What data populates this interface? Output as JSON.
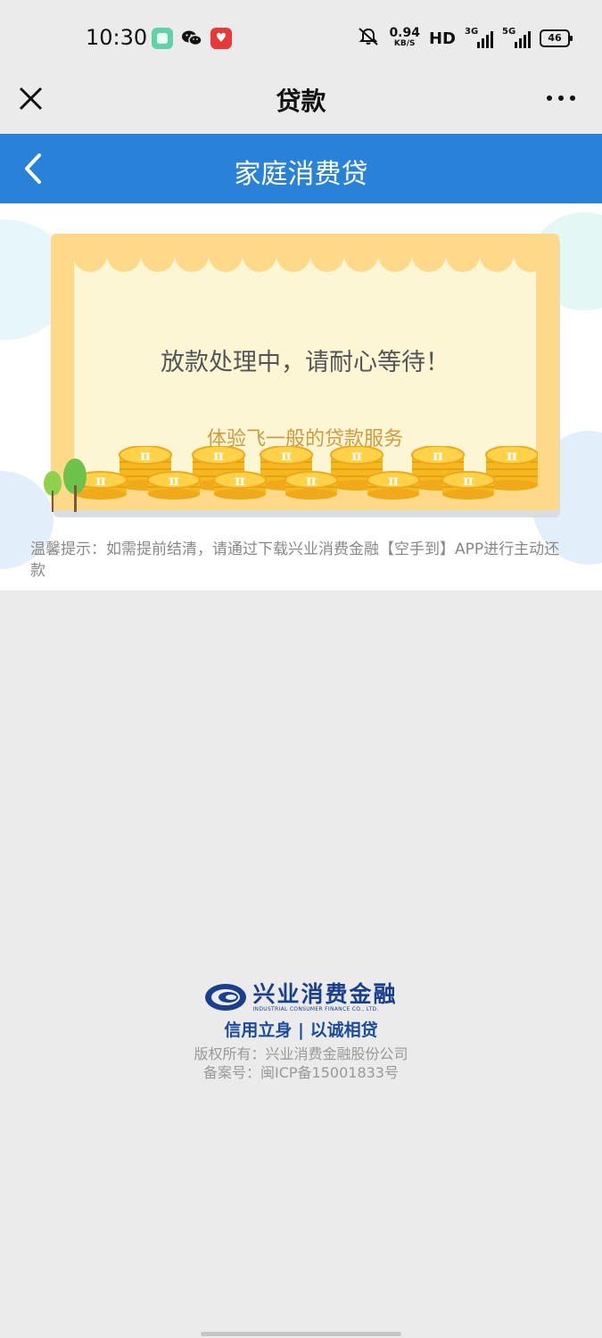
{
  "status_bar": {
    "time": "10:30",
    "network_speed_value": "0.94",
    "network_speed_unit": "KB/S",
    "hd_label": "HD",
    "sim1_label": "3G",
    "sim2_label": "5G",
    "battery_level": "46"
  },
  "title_bar": {
    "title": "贷款"
  },
  "header": {
    "title": "家庭消费贷"
  },
  "card": {
    "message": "放款处理中，请耐心等待！",
    "subtitle": "体验飞一般的贷款服务",
    "coin_symbol": "π"
  },
  "tip": {
    "text": "温馨提示：如需提前结清，请通过下载兴业消费金融【空手到】APP进行主动还款"
  },
  "footer": {
    "logo_cn": "兴业消费金融",
    "logo_en": "INDUSTRIAL CONSUMER FINANCE CO., LTD.",
    "slogan": "信用立身 | 以诚相贷",
    "copyright": "版权所有：兴业消费金融股份公司",
    "icp": "备案号：闽ICP备15001833号"
  },
  "colors": {
    "header_blue": "#2a82d8",
    "frame_orange": "#ffd98a",
    "frame_inner": "#fcf6d4",
    "coin_gold": "#f7c22f",
    "brand_navy": "#1a3f8c"
  }
}
